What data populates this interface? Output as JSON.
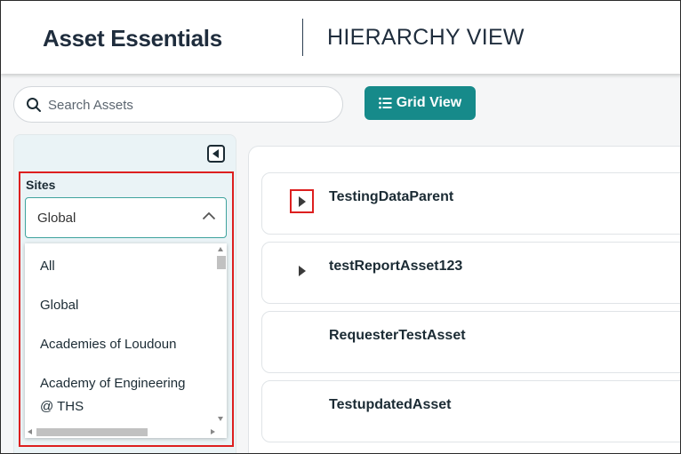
{
  "header": {
    "app_title": "Asset Essentials",
    "view_title": "HIERARCHY VIEW"
  },
  "search": {
    "placeholder": "Search Assets",
    "value": ""
  },
  "toolbar": {
    "grid_view_label": "Grid View"
  },
  "sidebar": {
    "sites_label": "Sites",
    "selected_site": "Global",
    "options": [
      "All",
      "Global",
      "Academies of Loudoun",
      "Academy of Engineering",
      "@ THS"
    ]
  },
  "assets": [
    {
      "name": "TestingDataParent",
      "expandable": true
    },
    {
      "name": "testReportAsset123",
      "expandable": true
    },
    {
      "name": "RequesterTestAsset",
      "expandable": false
    },
    {
      "name": "TestupdatedAsset",
      "expandable": false
    }
  ],
  "colors": {
    "accent": "#168a8a",
    "highlight": "#dd1f1f",
    "sidebar_bg": "#eaf3f6"
  }
}
